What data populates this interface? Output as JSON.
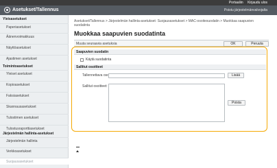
{
  "header": {
    "top_links": [
      "Portaaliin",
      "Kirjaudu ulos"
    ],
    "app_title": "Asetukset/Tallennus",
    "portal_link": "Poistu järjestelmänvalvojalta"
  },
  "sidebar": {
    "groups": [
      {
        "label": "Yleisasetukset",
        "items": [
          "Paperiasetukset",
          "Äänenvoimakkuus",
          "Näyttöasetukset",
          "Ajastimen asetukset"
        ]
      },
      {
        "label": "Toimintoasetukset",
        "items": [
          "Yleiset asetukset",
          "Kopioasetukset",
          "Faksiasetukset",
          "Skannausasetukset",
          "Tulostimen asetukset",
          "Tulostusraporttiasetukset"
        ]
      },
      {
        "label": "Järjestelmän hallinta-asetukset",
        "items": [
          "Järjestelmän hallinta",
          "Verkkoasetukset",
          "Suojausasetukset"
        ]
      }
    ],
    "active_item": "Suojausasetukset"
  },
  "main": {
    "breadcrumb": "Asetukset/Tallennus > Järjestelmän hallinta-asetukset: Suojausasetukset > MAC-osoitesuodatin > Muokkaa saapuvien suodatinta",
    "title": "Muokkaa saapuvien suodatinta",
    "toolbar_label": "Muuta seuraavia asetuksia",
    "ok_label": "OK",
    "cancel_label": "Peruuta",
    "filter_section_title": "Saapuvien suodatin",
    "enable_checkbox_label": "Käytä suodatinta",
    "enable_checked": false,
    "allowed_section_title": "Sallitut osoitteet",
    "address_input_label": "Tallennettava osoite:",
    "address_input_value": "",
    "add_label": "Lisää",
    "allowed_list_label": "Sallitut osoitteet:",
    "allowed_addresses": [],
    "delete_label": "Poista"
  },
  "colors": {
    "topbar": "#3c3c3c",
    "titlebar": "#555b62",
    "sidebar": "#eceff1",
    "highlight": "#f5a800"
  },
  "icons": {
    "logo": "canon-settings-logo",
    "back_to_top": "arrow-up-to-top-icon"
  }
}
